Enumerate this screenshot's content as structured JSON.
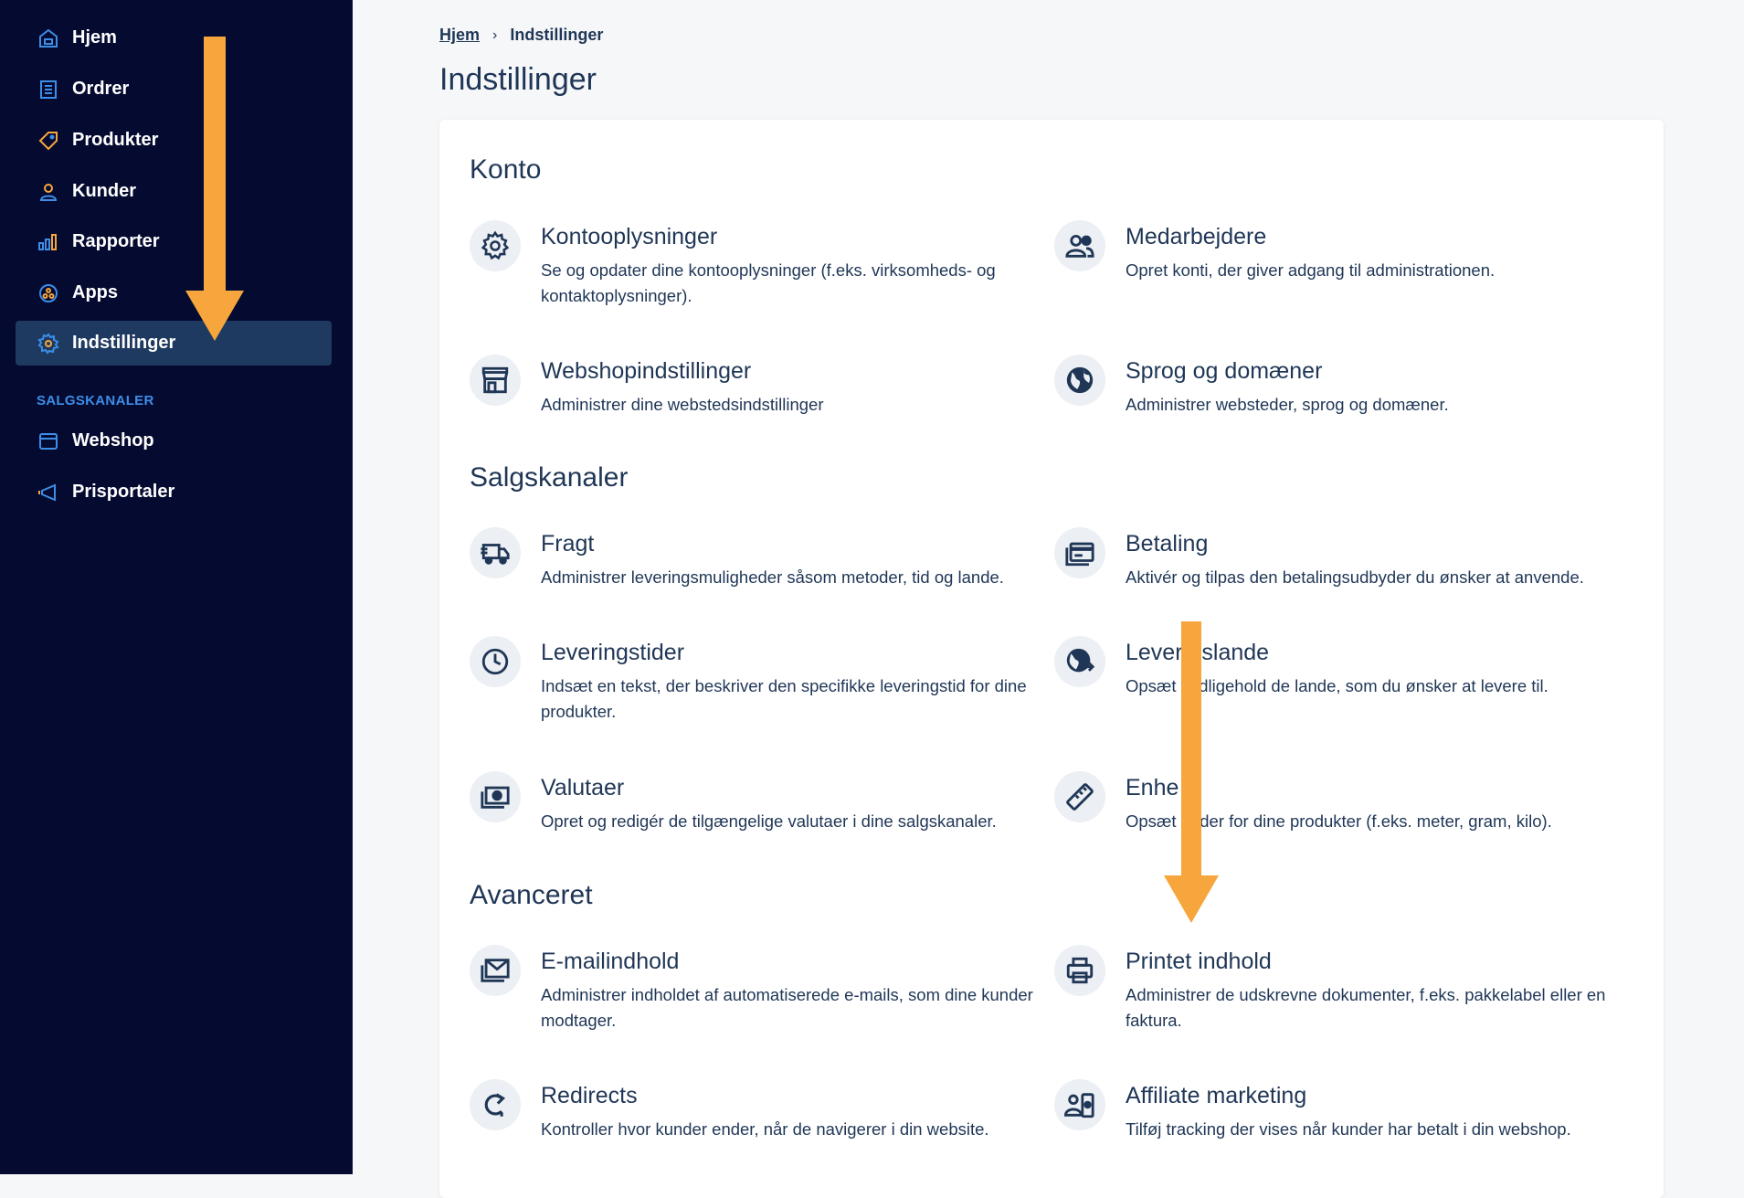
{
  "sidebar": {
    "items": [
      {
        "label": "Hjem",
        "icon": "home-icon"
      },
      {
        "label": "Ordrer",
        "icon": "orders-icon"
      },
      {
        "label": "Produkter",
        "icon": "tag-icon"
      },
      {
        "label": "Kunder",
        "icon": "user-icon"
      },
      {
        "label": "Rapporter",
        "icon": "bar-chart-icon"
      },
      {
        "label": "Apps",
        "icon": "apps-icon"
      },
      {
        "label": "Indstillinger",
        "icon": "gear-icon"
      }
    ],
    "section_label": "SALGSKANALER",
    "channels": [
      {
        "label": "Webshop",
        "icon": "browser-icon"
      },
      {
        "label": "Prisportaler",
        "icon": "megaphone-icon"
      }
    ]
  },
  "breadcrumb": {
    "home": "Hjem",
    "current": "Indstillinger"
  },
  "page_title": "Indstillinger",
  "sections": {
    "konto": {
      "title": "Konto",
      "items": [
        {
          "title": "Kontooplysninger",
          "desc": "Se og opdater dine kontooplysninger (f.eks. virksomheds- og kontaktoplysninger).",
          "icon": "gear-icon"
        },
        {
          "title": "Medarbejdere",
          "desc": "Opret konti, der giver adgang til administrationen.",
          "icon": "users-icon"
        },
        {
          "title": "Webshopindstillinger",
          "desc": "Administrer dine webstedsindstillinger",
          "icon": "store-icon"
        },
        {
          "title": "Sprog og domæner",
          "desc": "Administrer websteder, sprog og domæner.",
          "icon": "globe-icon"
        }
      ]
    },
    "salgskanaler": {
      "title": "Salgskanaler",
      "items": [
        {
          "title": "Fragt",
          "desc": "Administrer leveringsmuligheder såsom metoder, tid og lande.",
          "icon": "truck-icon"
        },
        {
          "title": "Betaling",
          "desc": "Aktivér og tilpas den betalingsudbyder du ønsker at anvende.",
          "icon": "credit-card-icon"
        },
        {
          "title": "Leveringstider",
          "desc": "Indsæt en tekst, der beskriver den specifikke leveringstid for dine produkter.",
          "icon": "clock-icon"
        },
        {
          "title": "Lever gslande",
          "desc": "Opsæt vedligehold de lande, som du ønsker at levere til.",
          "icon": "globe-arrow-icon"
        },
        {
          "title": "Valutaer",
          "desc": "Opret og redigér de tilgængelige valutaer i dine salgskanaler.",
          "icon": "money-icon"
        },
        {
          "title": "Enhe r",
          "desc": "Opsæt heder for dine produkter (f.eks. meter, gram, kilo).",
          "icon": "ruler-icon"
        }
      ]
    },
    "avanceret": {
      "title": "Avanceret",
      "items": [
        {
          "title": "E-mailindhold",
          "desc": "Administrer indholdet af automatiserede e-mails, som dine kunder modtager.",
          "icon": "mail-icon"
        },
        {
          "title": "Printet indhold",
          "desc": "Administrer de udskrevne dokumenter, f.eks. pakkelabel eller en faktura.",
          "icon": "printer-icon"
        },
        {
          "title": "Redirects",
          "desc": "Kontroller hvor kunder ender, når de navigerer i din website.",
          "icon": "redirect-icon"
        },
        {
          "title": "Affiliate marketing",
          "desc": "Tilføj tracking der vises når kunder har betalt i din webshop.",
          "icon": "affiliate-icon"
        }
      ]
    }
  },
  "colors": {
    "sidebar_bg": "#050a30",
    "active_bg": "#1f3a60",
    "accent": "#3d8ee8",
    "orange": "#f6a63c",
    "text": "#1f3656"
  }
}
